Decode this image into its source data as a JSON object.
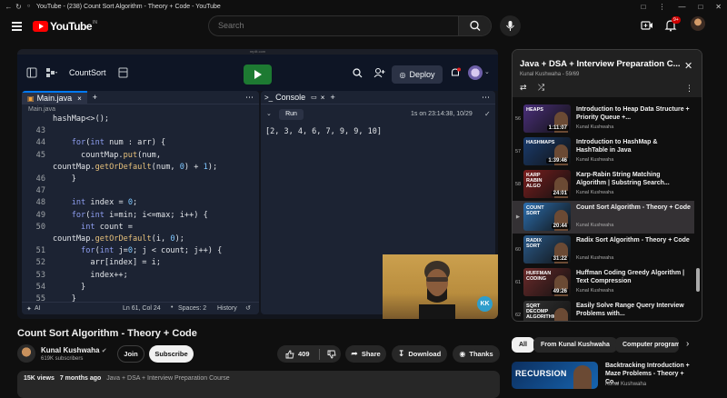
{
  "window": {
    "title": "YouTube - (238) Count Sort Algorithm - Theory + Code - YouTube"
  },
  "header": {
    "logo_word": "YouTube",
    "logo_region": "IN",
    "search_placeholder": "Search",
    "notification_count": "9+"
  },
  "player": {
    "url_hint": "replit.com",
    "repl_name": "CountSort",
    "deploy_label": "Deploy",
    "editor_tab": "Main.java",
    "breadcrumb": "Main.java",
    "console_tab": "Console",
    "run_label": "Run",
    "run_time": "1s on 23:14:38, 10/29",
    "console_output": "[2, 3, 4, 6, 7, 9, 9, 10]",
    "status_ai": "AI",
    "status_pos": "Ln 61, Col 24",
    "status_spaces": "Spaces: 2",
    "status_history": "History",
    "webcam_logo": "KK",
    "code_lines": [
      {
        "n": "",
        "t": "hashMap<>();"
      },
      {
        "n": "43",
        "t": ""
      },
      {
        "n": "44",
        "t": "    for(int num : arr) {"
      },
      {
        "n": "45",
        "t": "      countMap.put(num,"
      },
      {
        "n": "",
        "t": "countMap.getOrDefault(num, 0) + 1);"
      },
      {
        "n": "46",
        "t": "    }"
      },
      {
        "n": "47",
        "t": ""
      },
      {
        "n": "48",
        "t": "    int index = 0;"
      },
      {
        "n": "49",
        "t": "    for(int i=min; i<=max; i++) {"
      },
      {
        "n": "50",
        "t": "      int count ="
      },
      {
        "n": "",
        "t": "countMap.getOrDefault(i, 0);"
      },
      {
        "n": "51",
        "t": "      for(int j=0; j < count; j++) {"
      },
      {
        "n": "52",
        "t": "        arr[index] = i;"
      },
      {
        "n": "53",
        "t": "        index++;"
      },
      {
        "n": "54",
        "t": "      }"
      },
      {
        "n": "55",
        "t": "    }"
      }
    ]
  },
  "video": {
    "title": "Count Sort Algorithm - Theory + Code",
    "channel": "Kunal Kushwaha",
    "subscribers": "619K subscribers",
    "join_label": "Join",
    "subscribe_label": "Subscribe",
    "likes": "409",
    "share_label": "Share",
    "download_label": "Download",
    "thanks_label": "Thanks",
    "views": "15K views",
    "age": "7 months ago",
    "playlist_link": "Java + DSA + Interview Preparation Course"
  },
  "playlist": {
    "title": "Java + DSA + Interview Preparation C...",
    "subtitle": "Kunal Kushwaha - 59/69",
    "items": [
      {
        "idx": "56",
        "title": "Introduction to Heap Data Structure + Priority Queue +...",
        "channel": "Kunal Kushwaha",
        "duration": "1:11:07",
        "thumb_text": "HEAPS"
      },
      {
        "idx": "57",
        "title": "Introduction to HashMap & HashTable in Java",
        "channel": "Kunal Kushwaha",
        "duration": "1:39:46",
        "thumb_text": "HASHMAPS"
      },
      {
        "idx": "58",
        "title": "Karp-Rabin String Matching Algorithm | Substring Search...",
        "channel": "Kunal Kushwaha",
        "duration": "24:01",
        "thumb_text": "KARP RABIN ALGO"
      },
      {
        "idx": "▶",
        "title": "Count Sort Algorithm - Theory + Code",
        "channel": "Kunal Kushwaha",
        "duration": "20:44",
        "thumb_text": "COUNT SORT"
      },
      {
        "idx": "60",
        "title": "Radix Sort Algorithm - Theory + Code",
        "channel": "Kunal Kushwaha",
        "duration": "31:22",
        "thumb_text": "RADIX SORT"
      },
      {
        "idx": "61",
        "title": "Huffman Coding Greedy Algorithm | Text Compression",
        "channel": "Kunal Kushwaha",
        "duration": "49:26",
        "thumb_text": "HUFFMAN CODING"
      },
      {
        "idx": "62",
        "title": "Easily Solve Range Query Interview Problems with...",
        "channel": "",
        "duration": "",
        "thumb_text": "SQRT DECOMP ALGORITHM"
      }
    ]
  },
  "chips": [
    "All",
    "From Kunal Kushwaha",
    "Computer program"
  ],
  "recommended": {
    "title": "Backtracking Introduction + Maze Problems - Theory + Co...",
    "channel": "Kunal Kushwaha",
    "thumb_text": "RECURSION"
  },
  "colors": {
    "bg": "#0f0f0f",
    "yt_red": "#ff0000",
    "run_green": "#1d7a32",
    "active_row": "#343134"
  }
}
